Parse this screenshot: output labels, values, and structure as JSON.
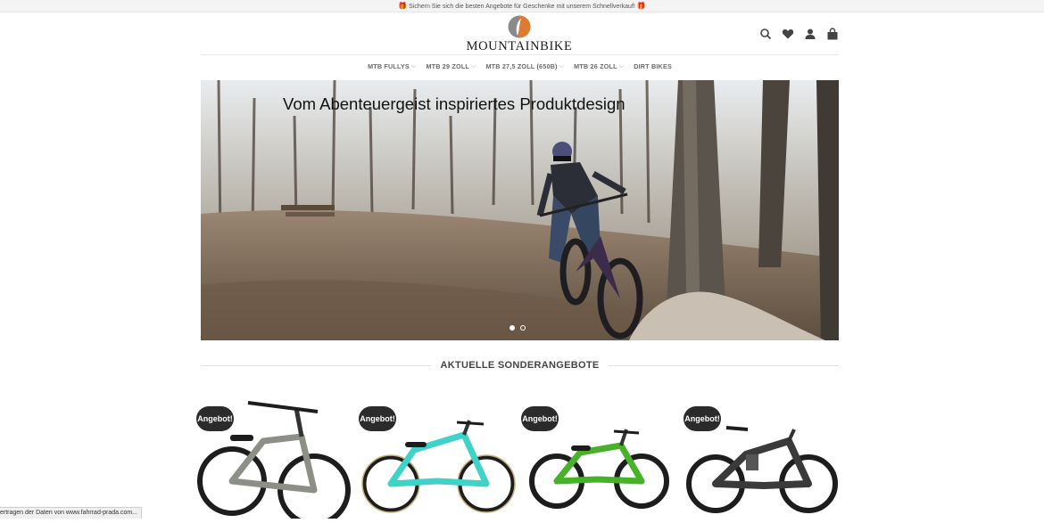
{
  "topbar": {
    "text": "Sichern Sie sich die besten Angebote für Geschenke mit unserem Schnellverkauf!",
    "gift_icon": "gift-icon",
    "gift_glyph": "🎁"
  },
  "header": {
    "logo_text": "MOUNTAINBIKE",
    "icons": [
      "search-icon",
      "heart-icon",
      "user-icon",
      "shopping-bag-icon"
    ]
  },
  "nav": {
    "items": [
      {
        "label": "MTB FULLYS",
        "has_dropdown": true
      },
      {
        "label": "MTB 29 ZOLL",
        "has_dropdown": true
      },
      {
        "label": "MTB 27,5 ZOLL (650B)",
        "has_dropdown": true
      },
      {
        "label": "MTB 26 ZOLL",
        "has_dropdown": true
      },
      {
        "label": "DIRT BIKES",
        "has_dropdown": false
      }
    ],
    "chevron": "⌵"
  },
  "hero": {
    "title": "Vom Abenteuergeist inspiriertes Produktdesign",
    "slides": 2,
    "active_slide": 1
  },
  "section": {
    "title": "AKTUELLE SONDERANGEBOTE"
  },
  "products": [
    {
      "badge": "Angebot!",
      "frame_color": "#8c8f86"
    },
    {
      "badge": "Angebot!",
      "frame_color": "#3fd2c9"
    },
    {
      "badge": "Angebot!",
      "frame_color": "#48b12a"
    },
    {
      "badge": "Angebot!",
      "frame_color": "#3a3a3a"
    }
  ],
  "status_bar": {
    "text": "ertragen der Daten von www.fahrrad-prada.com..."
  },
  "colors": {
    "accent_orange": "#e07a2e",
    "badge_bg": "#2b2b2b",
    "nav_text": "#6b6b6b"
  }
}
